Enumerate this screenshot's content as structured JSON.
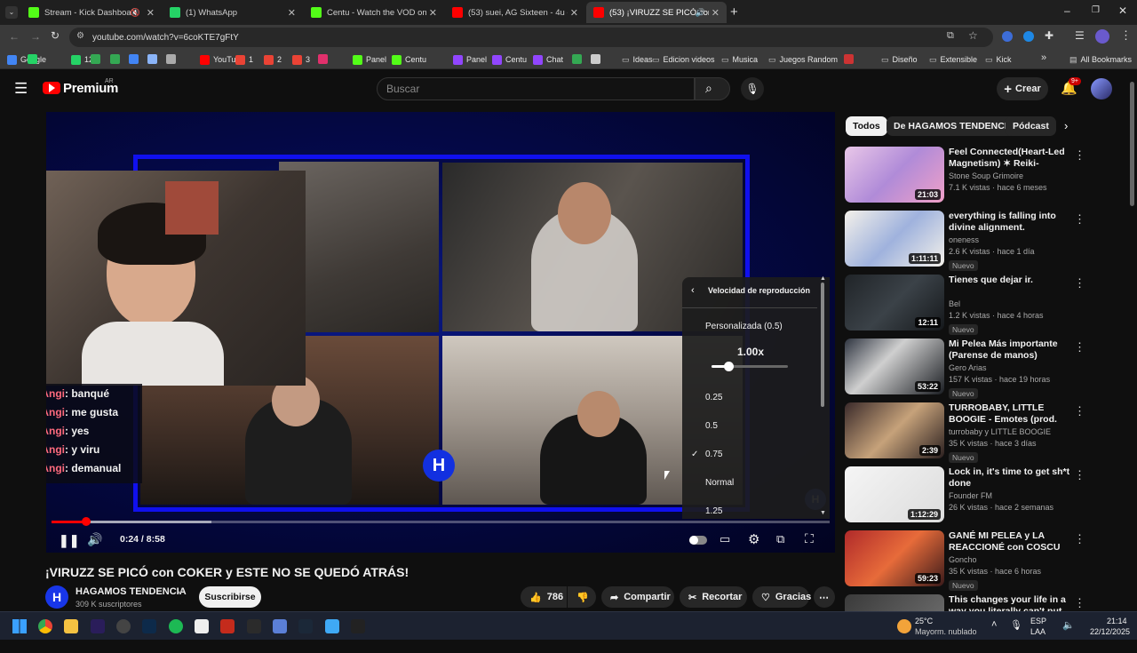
{
  "browser": {
    "tabs": [
      {
        "label": "Stream - Kick Dashboard",
        "icon": "kick-icon",
        "color": "#53fc18"
      },
      {
        "label": "(1) WhatsApp",
        "icon": "whatsapp-icon",
        "color": "#25d366"
      },
      {
        "label": "Centu - Watch the VOD on Kick",
        "icon": "kick-icon",
        "color": "#53fc18"
      },
      {
        "label": "(53) suei, AG Sixteen - 4u - You",
        "icon": "youtube-icon",
        "color": "#ff0000"
      },
      {
        "label": "(53) ¡VIRUZZ SE PICÓ con C",
        "icon": "youtube-icon",
        "color": "#ff0000"
      }
    ],
    "url": "youtube.com/watch?v=6coKTE7gFtY",
    "bookmarks": [
      "Google",
      "12",
      "YouTube",
      "1",
      "2",
      "3",
      "Panel",
      "Centu",
      "Panel",
      "Centu",
      "Chat",
      "Ideas",
      "Edicion videos",
      "Musica",
      "Juegos Random",
      "Diseño",
      "Extensible",
      "Kick",
      "All Bookmarks"
    ]
  },
  "youtube": {
    "logo": "Premium",
    "region": "AR",
    "search_placeholder": "Buscar",
    "create_label": "Crear",
    "notif_badge": "9+"
  },
  "video": {
    "chat": [
      {
        "name": "FabriAngi",
        "msg": ": banqué"
      },
      {
        "name": "FabriAngi",
        "msg": ": me gusta"
      },
      {
        "name": "FabriAngi",
        "msg": ": yes"
      },
      {
        "name": "FabriAngi",
        "msg": ": y viru"
      },
      {
        "name": "FabriAngi",
        "msg": ": demanual"
      }
    ],
    "time": "0:24 / 8:58",
    "progress": 0.045,
    "speed_menu": {
      "title": "Velocidad de reproducción",
      "custom": "Personalizada (0.5)",
      "value": "1.00x",
      "options": [
        "0.25",
        "0.5",
        "0.75",
        "Normal",
        "1.25"
      ],
      "selected": "0.75"
    },
    "title": "¡VIRUZZ SE PICÓ con COKER y ESTE NO SE QUEDÓ ATRÁS!",
    "channel": "HAGAMOS TENDENCIA",
    "subs": "309 K suscriptores",
    "subscribe": "Suscribirse",
    "likes": "786",
    "share": "Compartir",
    "clip": "Recortar",
    "thanks": "Gracias"
  },
  "chips": [
    "Todos",
    "De HAGAMOS TENDENCIA",
    "Pódcast"
  ],
  "related": [
    {
      "title": "Feel Connected(Heart-Led Magnetism) ✶ Reiki-Infused A...",
      "channel": "Stone Soup Grimoire",
      "meta": "7.1 K vistas · hace 6 meses",
      "dur": "21:03",
      "badge": ""
    },
    {
      "title": "everything is falling into divine alignment.",
      "channel": "oneness",
      "meta": "2.6 K vistas · hace 1 día",
      "dur": "1:11:11",
      "badge": "Nuevo"
    },
    {
      "title": "Tienes que dejar ir.",
      "channel": "Bel",
      "meta": "1.2 K vistas · hace 4 horas",
      "dur": "12:11",
      "badge": "Nuevo"
    },
    {
      "title": "Mi Pelea Más importante (Parense de manos)",
      "channel": "Gero Arias",
      "meta": "157 K vistas · hace 19 horas",
      "dur": "53:22",
      "badge": "Nuevo"
    },
    {
      "title": "TURROBABY, LITTLE BOOGIE - Emotes (prod. ezeq)",
      "channel": "turrobaby y LITTLE BOOGIE",
      "meta": "35 K vistas · hace 3 días",
      "dur": "2:39",
      "badge": "Nuevo"
    },
    {
      "title": "Lock in, it's time to get sh*t done",
      "channel": "Founder FM",
      "meta": "26 K vistas · hace 2 semanas",
      "dur": "1:12:29",
      "badge": ""
    },
    {
      "title": "GANÉ MI PELEA y LA REACCIONÉ con COSCU",
      "channel": "Goncho",
      "meta": "35 K vistas · hace 6 horas",
      "dur": "59:23",
      "badge": "Nuevo"
    },
    {
      "title": "This changes your life in a way you literally can't put into ...",
      "channel": "",
      "meta": "",
      "dur": "",
      "badge": ""
    }
  ],
  "taskbar": {
    "weather_temp": "25°C",
    "weather_desc": "Mayorm. nublado",
    "lang": "ESP",
    "lang2": "LAA",
    "time": "21:14",
    "date": "22/12/2025"
  }
}
